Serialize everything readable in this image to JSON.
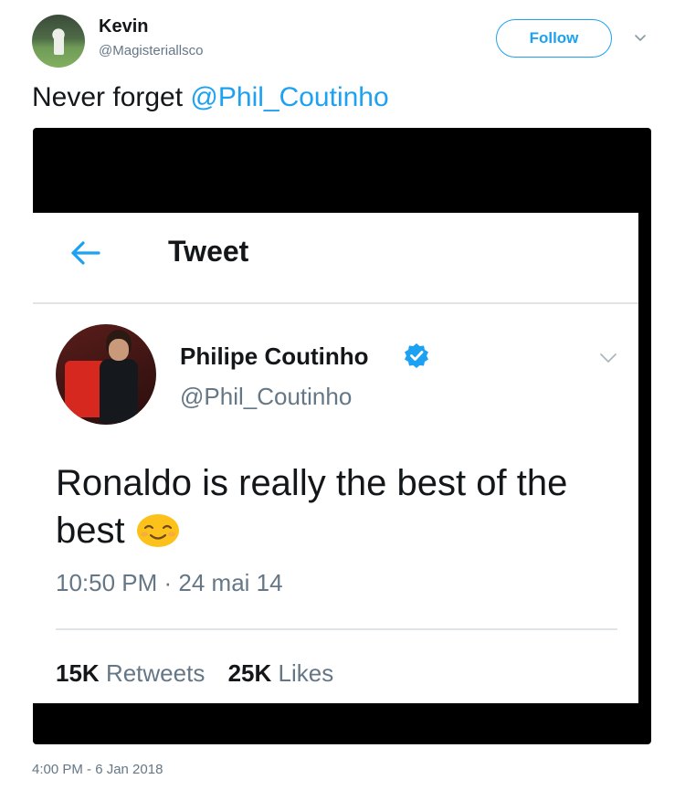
{
  "outer": {
    "name": "Kevin",
    "handle": "@Magisteriallsco",
    "follow_label": "Follow",
    "text_prefix": "Never forget ",
    "mention": "@Phil_Coutinho",
    "timestamp": "4:00 PM - 6 Jan 2018"
  },
  "embedded": {
    "header_title": "Tweet",
    "name": "Philipe Coutinho",
    "handle": "@Phil_Coutinho",
    "text": "Ronaldo is really the best of the best",
    "timestamp": "10:50 PM · 24 mai 14",
    "retweets_count": "15K",
    "retweets_label": "Retweets",
    "likes_count": "25K",
    "likes_label": "Likes"
  },
  "icons": {
    "back": "arrow-left-icon",
    "verified": "verified-badge-icon",
    "caret": "chevron-down-icon",
    "emoji": "smiling-face-emoji"
  },
  "colors": {
    "accent": "#1da1f2",
    "secondary_text": "#657786",
    "primary_text": "#14171a"
  }
}
